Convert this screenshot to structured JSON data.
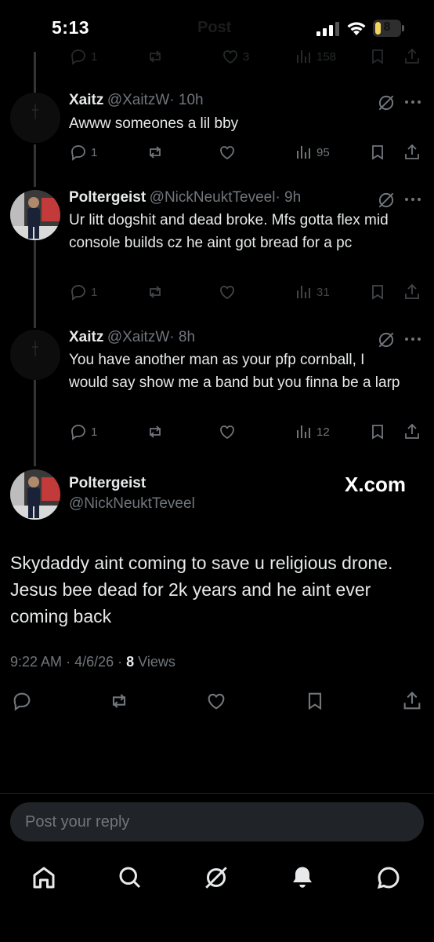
{
  "status_bar": {
    "time": "5:13",
    "ghost_title": "Post",
    "battery": "8",
    "battery_level": 0.08
  },
  "top_faded_row": {
    "likes": "3",
    "views": "158",
    "replies": "1"
  },
  "tweets": [
    {
      "name": "Xaitz",
      "handle": "@XaitzW",
      "time": "· 10h",
      "text": "Awww someones a lil bby",
      "replies": "1",
      "views": "95"
    },
    {
      "name": "Poltergeist",
      "handle": "@NickNeuktTeveel",
      "time": "· 9h",
      "text": "Ur litt dogshit and dead broke. Mfs gotta flex mid console builds cz he aint got bread for a pc",
      "replies": "1",
      "views": "31"
    },
    {
      "name": "Xaitz",
      "handle": "@XaitzW",
      "time": "· 8h",
      "text": "You have another man as your pfp cornball, I would say show me a band but you finna be a larp",
      "replies": "1",
      "views": "12"
    }
  ],
  "main_post": {
    "name": "Poltergeist",
    "handle": "@NickNeuktTeveel",
    "watermark": "X.com",
    "text": "Skydaddy aint coming to save u religious drone. Jesus bee dead for 2k years and he aint ever coming back",
    "time": "9:22 AM",
    "date": "4/6/26",
    "views_count": "8",
    "views_label": "Views"
  },
  "reply": {
    "placeholder": "Post your reply"
  },
  "nav": {
    "items": [
      "home-icon",
      "search-icon",
      "grok-icon",
      "notifications-icon",
      "messages-icon"
    ]
  },
  "colors": {
    "background": "#000000",
    "text": "#e7e9ea",
    "muted": "#71767b",
    "battery": "#f2d35c"
  }
}
